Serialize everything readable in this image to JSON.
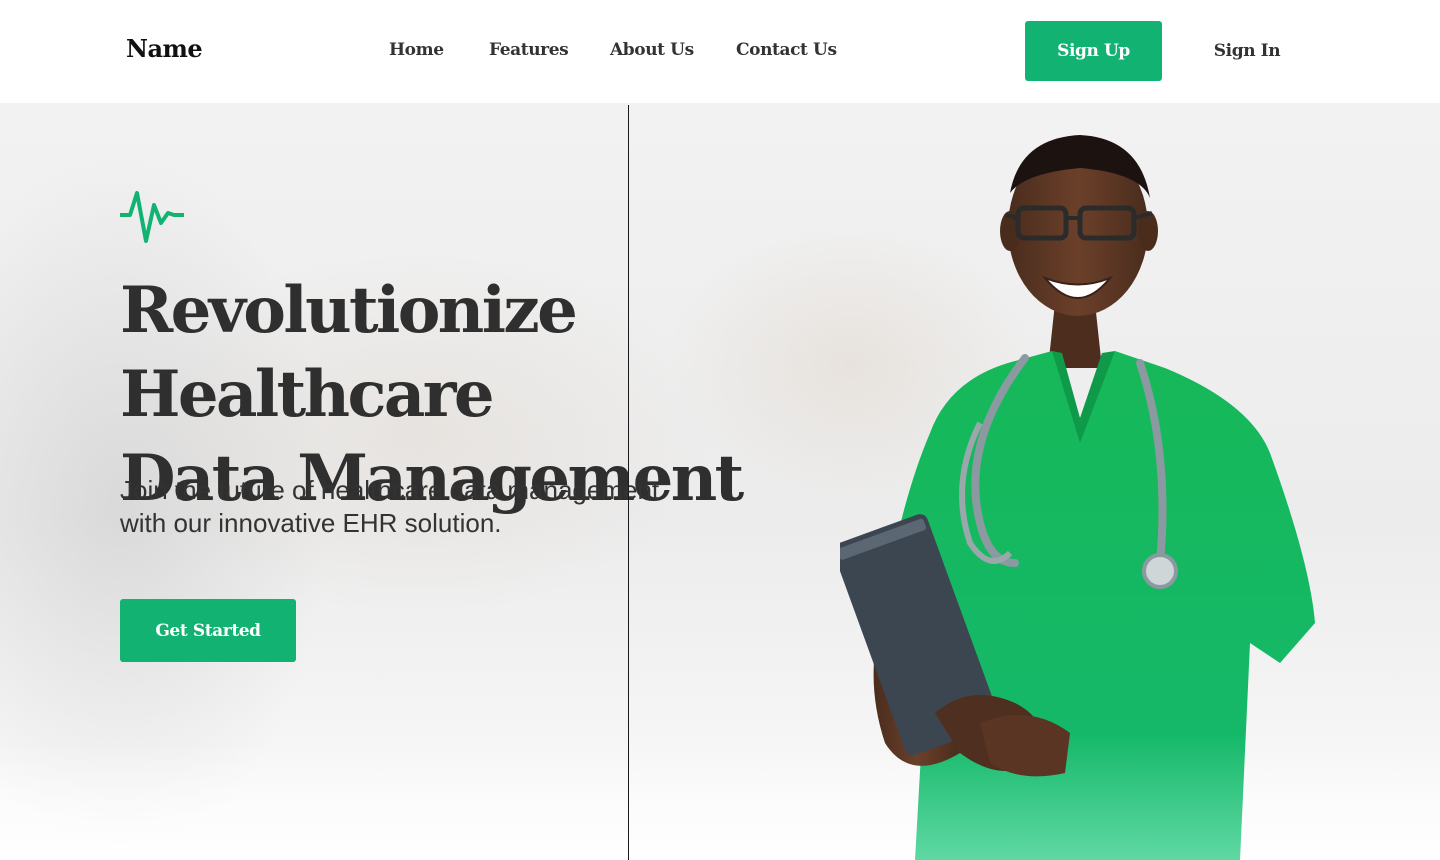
{
  "header": {
    "logo": "Name",
    "nav": [
      "Home",
      "Features",
      "About Us",
      "Contact Us"
    ],
    "sign_up": "Sign Up",
    "sign_in": "Sign In"
  },
  "hero": {
    "icon": "heartbeat-pulse-icon",
    "headline_line1": "Revolutionize Healthcare",
    "headline_line2": "Data Management",
    "subtext_line1": "Join the future of healthcare data management",
    "subtext_line2": "with our innovative EHR solution.",
    "cta": "Get Started",
    "image": "doctor-in-green-scrubs-holding-tablet"
  },
  "colors": {
    "accent": "#11b272",
    "text": "#333333",
    "background": "#ffffff"
  }
}
